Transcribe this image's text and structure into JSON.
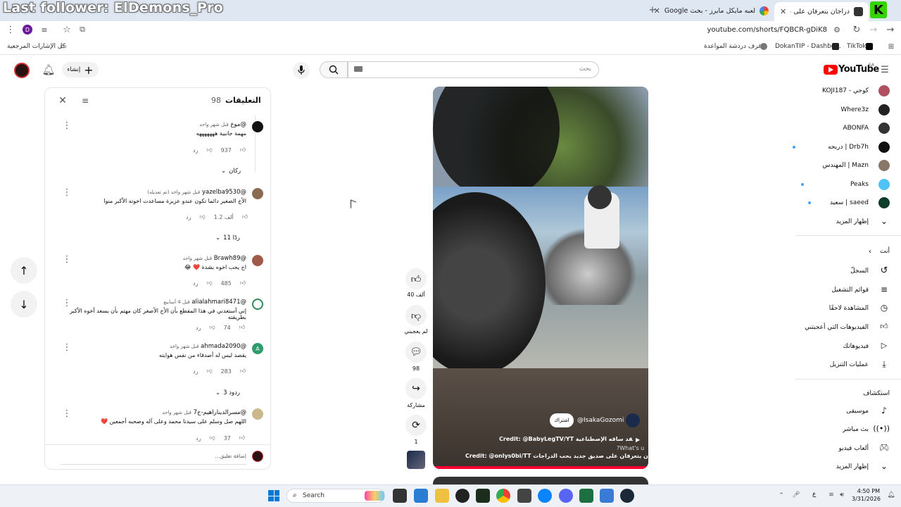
{
  "overlay": {
    "title": "Last follower: ElDemons_Pro"
  },
  "tabs": [
    {
      "label": "دراجان يتعرفان على صديق جـ",
      "active": true
    },
    {
      "label": "لعبه مايكل مايرز - بحث Google",
      "active": false
    }
  ],
  "address": {
    "url": "youtube.com/shorts/FQBCR-gDiK8"
  },
  "bookmarks": {
    "all_label": "كل الإشارات المرجعية",
    "items": [
      "غرف دردشة المواعدة...",
      "DokanTIP - Dashbo...",
      "TikTok"
    ]
  },
  "profile_letter": "D",
  "header": {
    "create_label": "إنشاء",
    "search_placeholder": "بحث",
    "logo_text": "YouTube",
    "logo_region": "SA"
  },
  "comments_panel": {
    "title": "التعليقات",
    "count": "98",
    "add_placeholder": "إضافة تعليق...",
    "comments": [
      {
        "user": "@موع",
        "time": "قبل شهر واحد",
        "text": "مهمة جانبية هههههههه",
        "likes": "937",
        "reply_label": "رد",
        "replies": "ركان"
      },
      {
        "user": "@yazelba9530",
        "time": "قبل شهر واحد (تم تعديله)",
        "text": "الأخ الصغير دائما تكون عندو عزيزة مساعدت اخوته الأكبر منوا",
        "likes": "1.2 ألف",
        "reply_label": "رد",
        "replies": "11 ردًا"
      },
      {
        "user": "@Brawh89",
        "time": "قبل شهر واحد",
        "text": "اخ يحب اخوه بشدة ❤️ 😂",
        "likes": "485",
        "reply_label": "رد",
        "replies": ""
      },
      {
        "user": "@alialahmari8471",
        "time": "قبل 4 أسابيع",
        "text": "إني أستعدني في هذا المقطع بأن الأخ الأصغر كان مهتم بأن يسعد  أخوه الأكبر بطريقته",
        "likes": "74",
        "reply_label": "رد",
        "replies": ""
      },
      {
        "user": "@ahmada2090",
        "time": "قبل شهر واحد",
        "text": "يقصد ليس له أصدقاء من نفس هوايته",
        "likes": "283",
        "reply_label": "رد",
        "replies": "3 ردود"
      },
      {
        "user": "@مسرالديناراهيم-ج7",
        "time": "قبل شهر واحد",
        "text": "اللهم صل وسلم على سيدنا محمد وعلى آله وصحبه أجمعين ❤️",
        "likes": "37",
        "reply_label": "رد",
        "replies": ""
      }
    ]
  },
  "video": {
    "channel": "@IsakaGozomi",
    "subscribe_label": "اشتراك",
    "caption_line1": "Credit: @BabyLegTV/YT ‏دراج يتقد ساقه الإصطناعية",
    "caption_line2": "Credit: @onlys0bi/TT ‏دراجان يتعرفان على صديق جديد يحب الدراجات",
    "whats_up": "?What's u"
  },
  "actions": [
    {
      "name": "like",
      "label": "40 ألف"
    },
    {
      "name": "dislike",
      "label": "لم يعجبني"
    },
    {
      "name": "comments",
      "label": "98"
    },
    {
      "name": "share",
      "label": "مشاركة"
    },
    {
      "name": "remix",
      "label": "1"
    }
  ],
  "sidebar": {
    "subscriptions": [
      {
        "label": "كوجي - KOJI187",
        "color": "#b05060",
        "dot": false
      },
      {
        "label": "Where3z",
        "color": "#222222",
        "dot": false
      },
      {
        "label": "ABONFA",
        "color": "#333333",
        "dot": false
      },
      {
        "label": "Drb7h | دربحه",
        "color": "#111111",
        "dot": true
      },
      {
        "label": "Mazn | المهندس",
        "color": "#887766",
        "dot": false
      },
      {
        "label": "Peaks",
        "color": "#4fc3f7",
        "dot": true
      },
      {
        "label": "saeed | سعيد",
        "color": "#0f3d2a",
        "dot": true
      }
    ],
    "show_more": "إظهار المزيد",
    "you_label": "أنت",
    "you_items": [
      "السجلّ",
      "قوائم التشغيل",
      "المشاهدة لاحقًا",
      "الفيديوهات التي أعجبتني",
      "فيديوهاتك",
      "عمليات التنزيل"
    ],
    "explore_label": "استكشاف",
    "explore_items": [
      "موسيقى",
      "بث مباشر",
      "ألعاب فيديو",
      "إظهار المزيد"
    ]
  },
  "taskbar": {
    "search_label": "Search",
    "time": "4:50 PM",
    "date": "3/31/2026",
    "lang": "ع"
  }
}
